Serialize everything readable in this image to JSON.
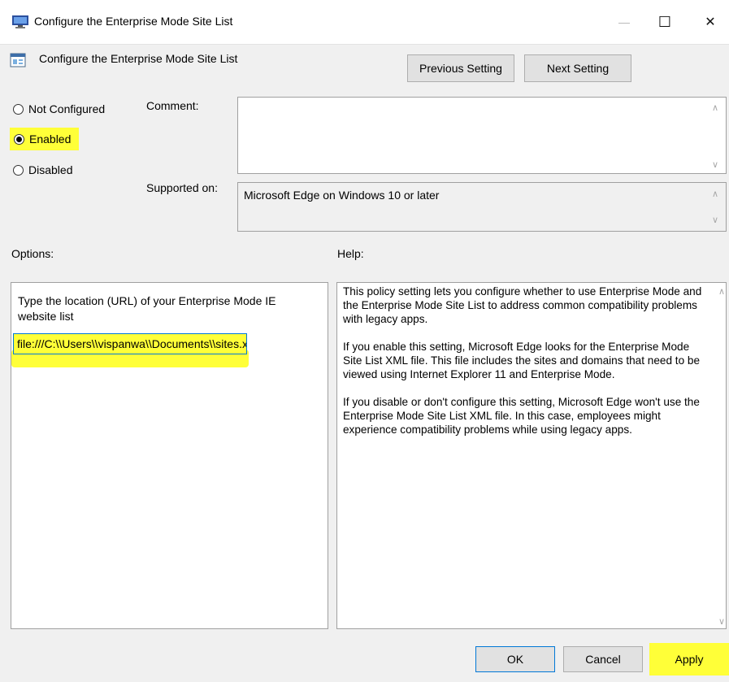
{
  "window": {
    "title": "Configure the Enterprise Mode Site List",
    "controls": {
      "minimize": "—",
      "maximize": "☐",
      "close": "✕"
    }
  },
  "header": {
    "setting_title": "Configure the Enterprise Mode Site List",
    "previous_label": "Previous Setting",
    "next_label": "Next Setting"
  },
  "state": {
    "options": [
      {
        "label": "Not Configured",
        "selected": false
      },
      {
        "label": "Enabled",
        "selected": true
      },
      {
        "label": "Disabled",
        "selected": false
      }
    ]
  },
  "comment": {
    "label": "Comment:",
    "value": ""
  },
  "supported": {
    "label": "Supported on:",
    "value": "Microsoft Edge on Windows 10 or later"
  },
  "options": {
    "label": "Options:",
    "description": "Type the location (URL) of your Enterprise Mode IE website list",
    "url_value": "file:///C:\\\\Users\\\\vispanwa\\\\Documents\\\\sites.xml"
  },
  "help": {
    "label": "Help:",
    "paragraphs": [
      "This policy setting lets you configure whether to use Enterprise Mode and the Enterprise Mode Site List to address common compatibility problems with legacy apps.",
      "If you enable this setting, Microsoft Edge looks for the Enterprise Mode Site List XML file. This file includes the sites and domains that need to be viewed using Internet Explorer 11 and Enterprise Mode.",
      "If you disable or don't configure this setting, Microsoft Edge won't use the Enterprise Mode Site List XML file. In this case, employees might experience compatibility problems while using legacy apps."
    ]
  },
  "footer": {
    "ok_label": "OK",
    "cancel_label": "Cancel",
    "apply_label": "Apply"
  },
  "colors": {
    "highlight": "#ffff38",
    "focus": "#0078d7",
    "background": "#f0f0f0"
  }
}
